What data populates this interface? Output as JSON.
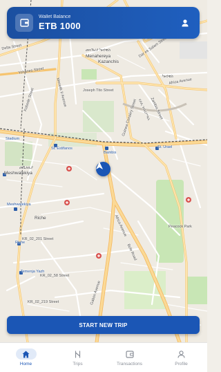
{
  "wallet": {
    "title": "Wallet Balance",
    "amount": "ETB 1000"
  },
  "map": {
    "labels": {
      "delta_street": "Delta Street",
      "gedam_sefer": "Gedam Sefer",
      "menahereya": "Menahereya",
      "kazanchis": "Kazanchis",
      "dar_es_salam_street": "Dar es Salam Street",
      "kazanchis_am": "ካዛንቺስ",
      "menahereya_am": "መናኸሪያ ካዛንቺስ",
      "yohanes_street": "Yohanes Street",
      "joseph_tito_street": "Joseph Tito Street",
      "africa_ave_top": "Africa Avenue",
      "kebede_street": "Kebede Street",
      "menelik_ii_avenue": "Menelik II Avenue",
      "guinea_conakry_street": "Guinea Conakry Street",
      "zambia_street": "Zambia Street",
      "haile_gebreselassie": "ሃይሌ ገብረሥላሴ",
      "stadium": "Stadium",
      "st_estifanos": "St. Estifanos",
      "bambis": "Bambis",
      "st_urael": "St. Urael",
      "meshwalekiya": "Meshwalekiya",
      "meshwalekiya_am": "መሿለኪያ",
      "riche": "Riche",
      "riche_blue": "Riche",
      "meshwalekiya_blue": "Meshwalekiya",
      "kr_02_201": "KR_02_201 Street",
      "temenja_yazh": "Temenja Yazh",
      "africa_avenue": "Africa Avenue",
      "gabon_avenue": "Gabon Avenue",
      "bole_road": "Bole Road",
      "peacock_park": "Peacock Park",
      "kr_02_219": "KR_02_219 Street",
      "kr_02_58": "KR_02_58 Street"
    },
    "marker_color": "#1b56b5"
  },
  "actions": {
    "start_trip": "START NEW TRIP"
  },
  "bottom_nav": {
    "items": [
      {
        "label": "Home",
        "icon": "home-icon",
        "active": true
      },
      {
        "label": "Trips",
        "icon": "route-icon",
        "active": false
      },
      {
        "label": "Transactions",
        "icon": "wallet-icon",
        "active": false
      },
      {
        "label": "Profile",
        "icon": "user-icon",
        "active": false
      }
    ]
  },
  "colors": {
    "primary": "#1b56b5",
    "road_major": "#f9c97a",
    "road_minor": "#ffffff",
    "park": "#c8e6b5",
    "map_bg": "#f2efe9"
  }
}
